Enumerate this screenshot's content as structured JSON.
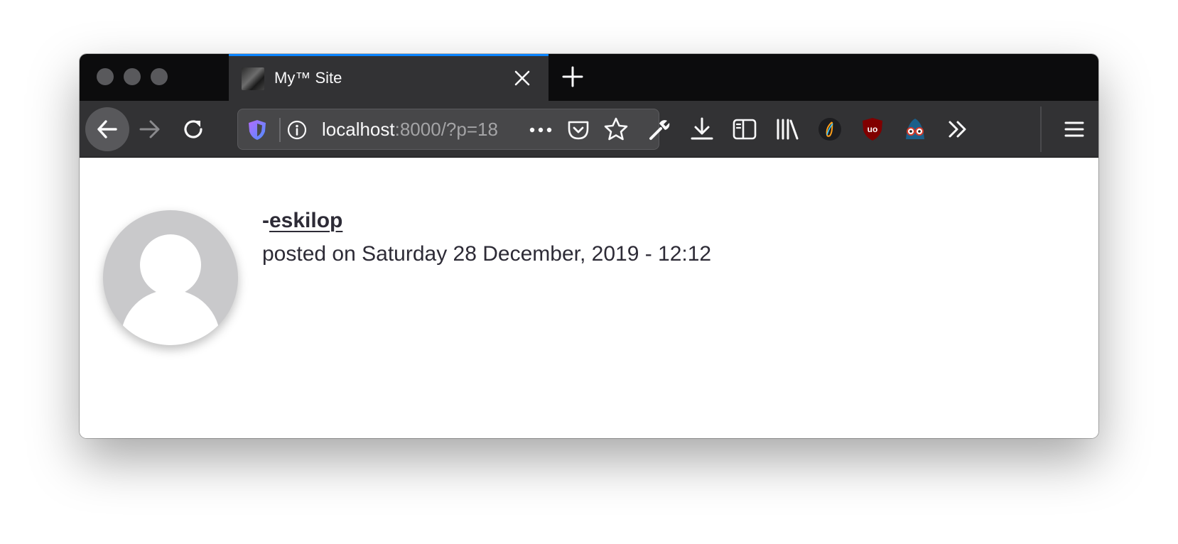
{
  "tab": {
    "title": "My™ Site"
  },
  "urlbar": {
    "host": "localhost",
    "rest": ":8000/?p=18"
  },
  "post": {
    "author_prefix": "-",
    "author": "eskilop",
    "posted_prefix": "posted on",
    "posted_date": "Saturday 28 December, 2019 - 12:12"
  },
  "colors": {
    "accent": "#0a84ff",
    "tabbar_bg": "#0c0c0d",
    "toolbar_bg": "#323234",
    "ublock_red": "#800000",
    "text": "#2d2b36"
  },
  "icons": {
    "toolbar": [
      "wrench-icon",
      "download-icon",
      "sidebar-icon",
      "library-icon",
      "extension-icon",
      "ublock-icon",
      "privacy-extension-icon",
      "overflow-icon",
      "menu-icon"
    ]
  }
}
